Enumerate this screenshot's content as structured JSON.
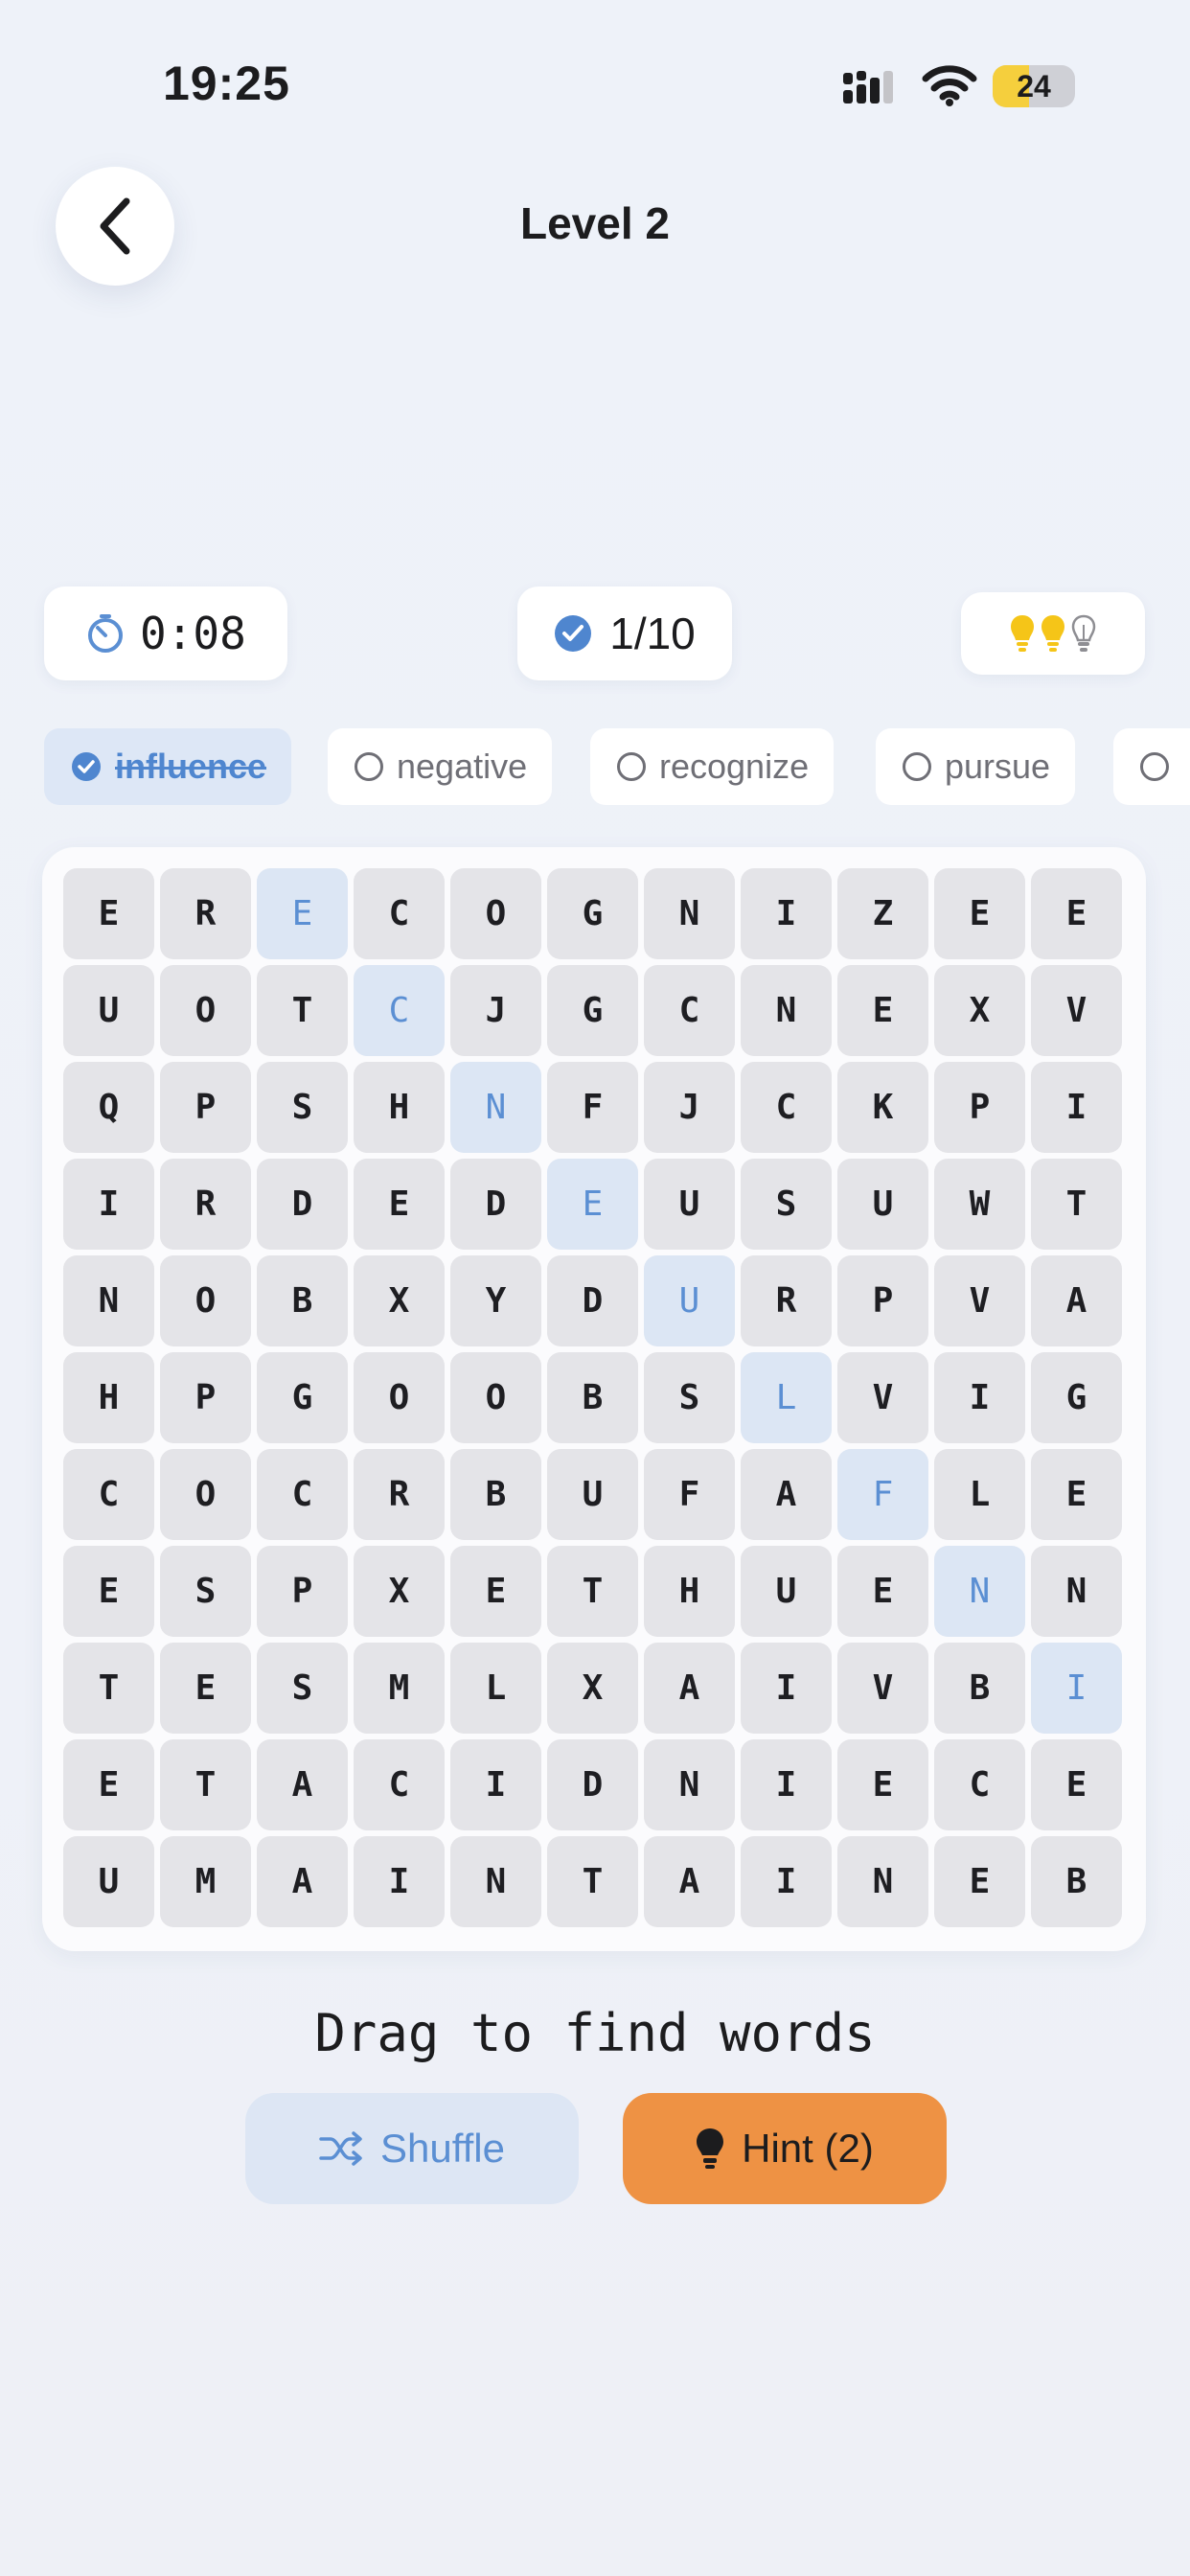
{
  "status_bar": {
    "time": "19:25",
    "battery": "24"
  },
  "header": {
    "title": "Level 2"
  },
  "stats": {
    "timer": "0:08",
    "progress": "1/10",
    "hints_remaining": 2,
    "hints_total": 3
  },
  "words": [
    {
      "label": "influence",
      "found": true
    },
    {
      "label": "negative",
      "found": false
    },
    {
      "label": "recognize",
      "found": false
    },
    {
      "label": "pursue",
      "found": false
    },
    {
      "label": "",
      "found": false
    }
  ],
  "grid": [
    [
      "E",
      "R",
      "E",
      "C",
      "O",
      "G",
      "N",
      "I",
      "Z",
      "E",
      "E"
    ],
    [
      "U",
      "O",
      "T",
      "C",
      "J",
      "G",
      "C",
      "N",
      "E",
      "X",
      "V"
    ],
    [
      "Q",
      "P",
      "S",
      "H",
      "N",
      "F",
      "J",
      "C",
      "K",
      "P",
      "I"
    ],
    [
      "I",
      "R",
      "D",
      "E",
      "D",
      "E",
      "U",
      "S",
      "U",
      "W",
      "T"
    ],
    [
      "N",
      "O",
      "B",
      "X",
      "Y",
      "D",
      "U",
      "R",
      "P",
      "V",
      "A"
    ],
    [
      "H",
      "P",
      "G",
      "O",
      "O",
      "B",
      "S",
      "L",
      "V",
      "I",
      "G"
    ],
    [
      "C",
      "O",
      "C",
      "R",
      "B",
      "U",
      "F",
      "A",
      "F",
      "L",
      "E"
    ],
    [
      "E",
      "S",
      "P",
      "X",
      "E",
      "T",
      "H",
      "U",
      "E",
      "N",
      "N"
    ],
    [
      "T",
      "E",
      "S",
      "M",
      "L",
      "X",
      "A",
      "I",
      "V",
      "B",
      "I"
    ],
    [
      "E",
      "T",
      "A",
      "C",
      "I",
      "D",
      "N",
      "I",
      "E",
      "C",
      "E"
    ],
    [
      "U",
      "M",
      "A",
      "I",
      "N",
      "T",
      "A",
      "I",
      "N",
      "E",
      "B"
    ]
  ],
  "found_cells": [
    [
      0,
      2
    ],
    [
      1,
      3
    ],
    [
      2,
      4
    ],
    [
      3,
      5
    ],
    [
      4,
      6
    ],
    [
      5,
      7
    ],
    [
      6,
      8
    ],
    [
      7,
      9
    ],
    [
      8,
      10
    ]
  ],
  "instruction": "Drag to find words",
  "buttons": {
    "shuffle": "Shuffle",
    "hint": "Hint (2)"
  },
  "colors": {
    "accent": "#5b8fd3",
    "hint_button": "#ee9244",
    "bulb_on": "#f5c518"
  }
}
